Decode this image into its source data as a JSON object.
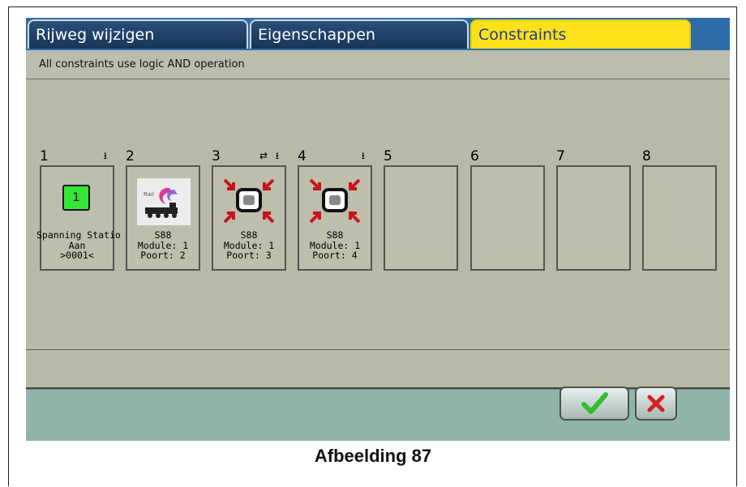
{
  "tabs": [
    {
      "label": "Rijweg wijzigen",
      "active": false
    },
    {
      "label": "Eigenschappen",
      "active": false
    },
    {
      "label": "Constraints",
      "active": true
    }
  ],
  "subtitle": "All constraints use logic AND operation",
  "slots": [
    {
      "number": "1",
      "icons": [
        "download-icon"
      ],
      "visual": "green-status-icon",
      "visual_text": "1",
      "lines": [
        "Spanning Statio",
        "Aan",
        ">0001<"
      ]
    },
    {
      "number": "2",
      "icons": [],
      "visual": "locomotive-logo-icon",
      "lines": [
        "S88",
        "Module: 1",
        "Poort: 2"
      ]
    },
    {
      "number": "3",
      "icons": [
        "route-icon",
        "download-icon"
      ],
      "visual": "feedback-sensor-icon",
      "lines": [
        "S88",
        "Module: 1",
        "Poort: 3"
      ]
    },
    {
      "number": "4",
      "icons": [
        "download-icon"
      ],
      "visual": "feedback-sensor-icon",
      "lines": [
        "S88",
        "Module: 1",
        "Poort: 4"
      ]
    },
    {
      "number": "5",
      "lines": []
    },
    {
      "number": "6",
      "lines": []
    },
    {
      "number": "7",
      "lines": []
    },
    {
      "number": "8",
      "lines": []
    }
  ],
  "buttons": {
    "ok_icon": "checkmark-icon",
    "cancel_icon": "x-icon"
  },
  "caption": "Afbeelding 87",
  "colors": {
    "tab_active": "#ffe11a",
    "tab_inactive": "#1d4170",
    "panel": "#b9b9a8",
    "bottom_bar": "#8fb5a6",
    "status_green": "#32e632",
    "arrow_red": "#c8141e",
    "ok_green": "#2fbf2f",
    "cancel_red": "#d42020"
  }
}
